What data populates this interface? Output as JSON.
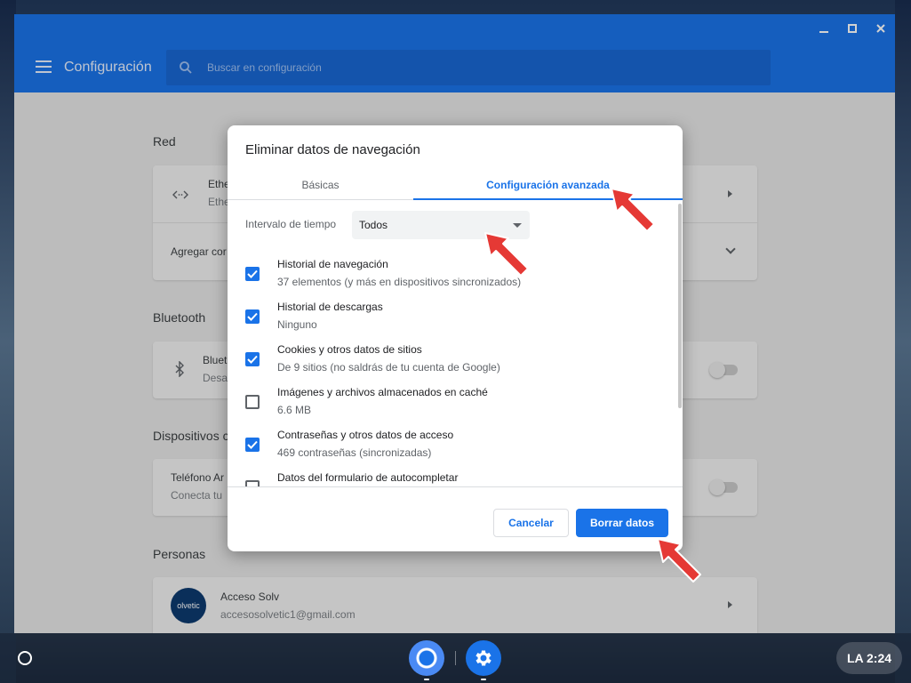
{
  "window": {
    "app_title": "Configuración",
    "search_placeholder": "Buscar en configuración"
  },
  "settings": {
    "sections": {
      "red": "Red",
      "bluetooth": "Bluetooth",
      "dispositivos": "Dispositivos c",
      "personas": "Personas"
    },
    "network": {
      "ethernet_title": "Ethe",
      "ethernet_sub": "Ethe",
      "add_connection": "Agregar cor"
    },
    "bluetooth_row": {
      "title": "Bluet",
      "sub": "Desa"
    },
    "phone_row": {
      "title": "Teléfono Ar",
      "sub": "Conecta tu"
    },
    "account": {
      "avatar_text": "olvetic",
      "name": "Acceso Solv",
      "email": "accesosolvetic1@gmail.com"
    }
  },
  "dialog": {
    "title": "Eliminar datos de navegación",
    "tabs": [
      {
        "label": "Básicas",
        "active": false
      },
      {
        "label": "Configuración avanzada",
        "active": true
      }
    ],
    "time_range_label": "Intervalo de tiempo",
    "time_range_value": "Todos",
    "items": [
      {
        "title": "Historial de navegación",
        "sub": "37 elementos (y más en dispositivos sincronizados)",
        "checked": true
      },
      {
        "title": "Historial de descargas",
        "sub": "Ninguno",
        "checked": true
      },
      {
        "title": "Cookies y otros datos de sitios",
        "sub": "De 9 sitios (no saldrás de tu cuenta de Google)",
        "checked": true
      },
      {
        "title": "Imágenes y archivos almacenados en caché",
        "sub": "6.6 MB",
        "checked": false
      },
      {
        "title": "Contraseñas y otros datos de acceso",
        "sub": "469 contraseñas (sincronizadas)",
        "checked": true
      },
      {
        "title": "Datos del formulario de autocompletar",
        "sub": "",
        "checked": false
      }
    ],
    "cancel_label": "Cancelar",
    "clear_label": "Borrar datos"
  },
  "shelf": {
    "status_text": "LA  2:24"
  },
  "colors": {
    "accent": "#1a73e8",
    "annotation": "#e53935"
  }
}
